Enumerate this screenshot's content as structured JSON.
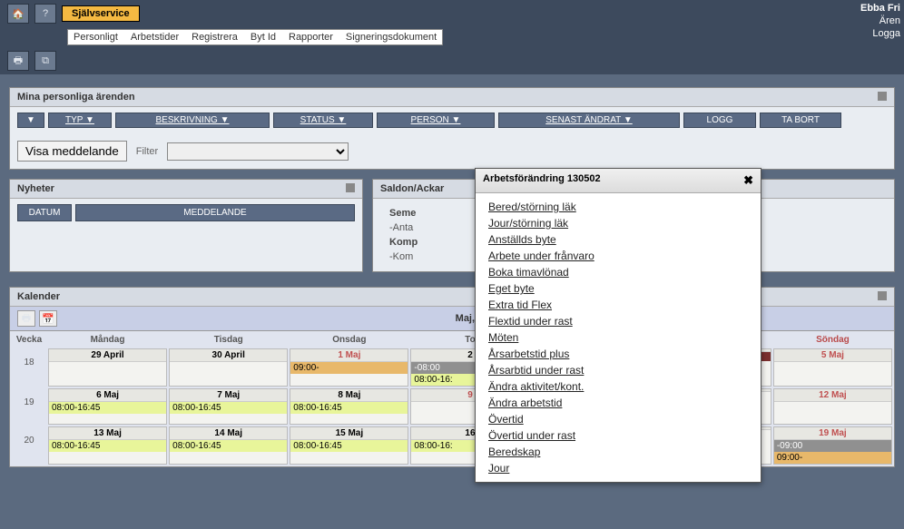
{
  "header": {
    "active_tab": "Självservice",
    "user_name": "Ebba Fri",
    "user_sub1": "Ären",
    "user_sub2": "Logga",
    "menu": [
      "Personligt",
      "Arbetstider",
      "Registrera",
      "Byt Id",
      "Rapporter",
      "Signeringsdokument"
    ]
  },
  "errands": {
    "title": "Mina personliga ärenden",
    "cols": {
      "typ": "TYP ▼",
      "besk": "BESKRIVNING ▼",
      "status": "STATUS ▼",
      "person": "PERSON ▼",
      "senast": "SENAST ÄNDRAT ▼",
      "logg": "LOGG",
      "tabort": "TA BORT"
    },
    "show_msg_btn": "Visa meddelande",
    "filter_label": "Filter"
  },
  "news": {
    "title": "Nyheter",
    "col_date": "DATUM",
    "col_msg": "MEDDELANDE"
  },
  "saldon": {
    "title": "Saldon/Ackar",
    "rows": [
      "Seme",
      "-Anta",
      "Komp",
      "-Kom"
    ]
  },
  "calendar": {
    "title": "Kalender",
    "month": "Maj, 20",
    "week_label": "Vecka",
    "days": [
      "Måndag",
      "Tisdag",
      "Onsdag",
      "To",
      "",
      "",
      "Söndag"
    ],
    "weeks": [
      {
        "num": "18",
        "cells": [
          {
            "date": "29 April",
            "entries": []
          },
          {
            "date": "30 April",
            "entries": []
          },
          {
            "date": "1 Maj",
            "holiday": true,
            "entries": [
              {
                "text": "09:00-",
                "cls": "entry-orange"
              }
            ]
          },
          {
            "date": "2",
            "entries": [
              {
                "text": "-08:00",
                "cls": "entry-gray"
              },
              {
                "text": "08:00-16:",
                "cls": "entry-yellow"
              }
            ]
          },
          {
            "date": "",
            "entries": []
          },
          {
            "date": "",
            "entries": [
              {
                "text": "",
                "cls": "entry-darkred"
              }
            ]
          },
          {
            "date": "5 Maj",
            "holiday": true,
            "entries": []
          }
        ]
      },
      {
        "num": "19",
        "cells": [
          {
            "date": "6 Maj",
            "entries": [
              {
                "text": "08:00-16:45",
                "cls": "entry-yellow"
              }
            ]
          },
          {
            "date": "7 Maj",
            "entries": [
              {
                "text": "08:00-16:45",
                "cls": "entry-yellow"
              }
            ]
          },
          {
            "date": "8 Maj",
            "entries": [
              {
                "text": "08:00-16:45",
                "cls": "entry-yellow"
              }
            ]
          },
          {
            "date": "9",
            "holiday": true,
            "entries": []
          },
          {
            "date": "",
            "entries": []
          },
          {
            "date": "",
            "entries": []
          },
          {
            "date": "12 Maj",
            "holiday": true,
            "entries": []
          }
        ]
      },
      {
        "num": "20",
        "cells": [
          {
            "date": "13 Maj",
            "entries": [
              {
                "text": "08:00-16:45",
                "cls": "entry-yellow"
              }
            ]
          },
          {
            "date": "14 Maj",
            "entries": [
              {
                "text": "08:00-16:45",
                "cls": "entry-yellow"
              }
            ]
          },
          {
            "date": "15 Maj",
            "entries": [
              {
                "text": "08:00-16:45",
                "cls": "entry-yellow"
              }
            ]
          },
          {
            "date": "16",
            "entries": [
              {
                "text": "08:00-16:",
                "cls": "entry-yellow"
              }
            ]
          },
          {
            "date": "",
            "entries": []
          },
          {
            "date": "",
            "entries": []
          },
          {
            "date": "19 Maj",
            "holiday": true,
            "entries": [
              {
                "text": "-09:00",
                "cls": "entry-gray"
              },
              {
                "text": "09:00-",
                "cls": "entry-orange"
              }
            ]
          }
        ]
      }
    ]
  },
  "popup": {
    "title": "Arbetsförändring 130502",
    "items": [
      "Bered/störning läk",
      "Jour/störning läk",
      "Anställds byte",
      "Arbete under frånvaro",
      "Boka timavlönad",
      "Eget byte",
      "Extra tid Flex",
      "Flextid under rast",
      "Möten",
      "Årsarbetstid plus",
      "Årsarbtid under rast",
      "Ändra aktivitet/kont.",
      "Ändra arbetstid",
      "Övertid",
      "Övertid under rast",
      "Beredskap",
      "Jour"
    ]
  }
}
